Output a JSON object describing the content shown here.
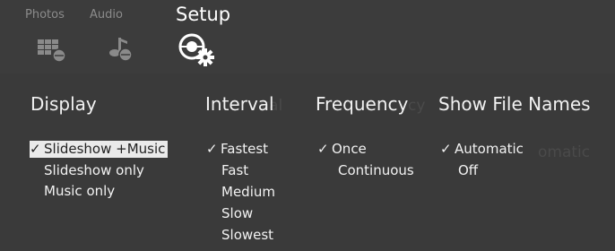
{
  "tabs": [
    {
      "label": "Photos",
      "icon": "photo-grid-icon"
    },
    {
      "label": "Audio",
      "icon": "music-note-icon"
    },
    {
      "label": "Setup",
      "icon": "setup-gear-icon"
    }
  ],
  "columns": [
    {
      "title": "Display",
      "options": [
        {
          "label": "Slideshow +Music",
          "checked": true
        },
        {
          "label": "Slideshow only",
          "checked": false
        },
        {
          "label": "Music only",
          "checked": false
        }
      ]
    },
    {
      "title": "Interval",
      "options": [
        {
          "label": "Fastest",
          "checked": true
        },
        {
          "label": "Fast",
          "checked": false
        },
        {
          "label": "Medium",
          "checked": false
        },
        {
          "label": "Slow",
          "checked": false
        },
        {
          "label": "Slowest",
          "checked": false
        }
      ]
    },
    {
      "title": "Frequency",
      "options": [
        {
          "label": "Once",
          "checked": true
        },
        {
          "label": "Continuous",
          "checked": false
        }
      ]
    },
    {
      "title": "Show File Names",
      "options": [
        {
          "label": "Automatic",
          "checked": true
        },
        {
          "label": "Off",
          "checked": false
        }
      ]
    }
  ],
  "check_mark": "✓",
  "colors": {
    "background": "#3a3a3a",
    "text": "#f2f2f2",
    "highlight": "#eaeaea",
    "inactive_tab": "#8b8b8b"
  }
}
